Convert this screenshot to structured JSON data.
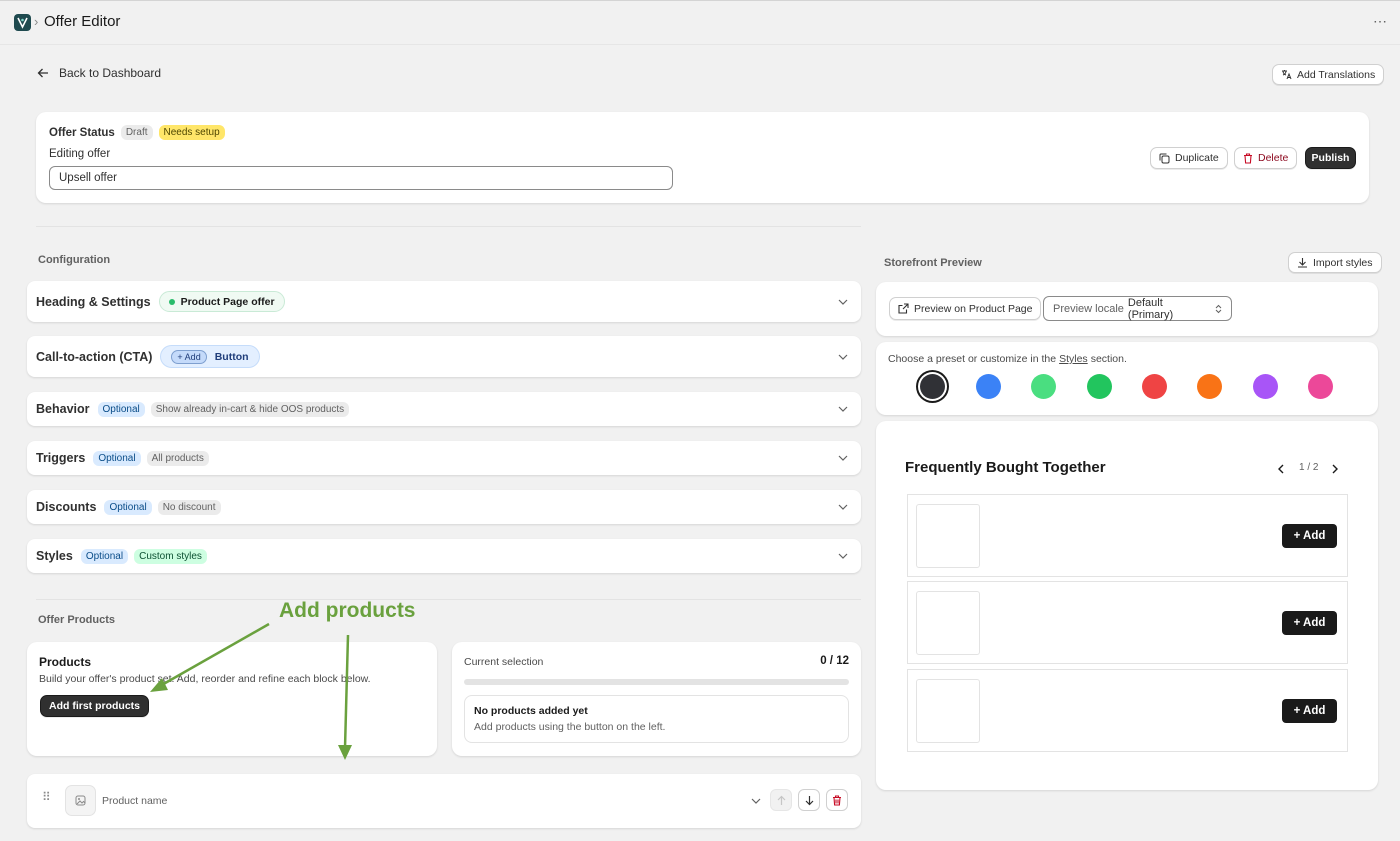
{
  "topbar": {
    "crumb_sep": "›",
    "title": "Offer Editor",
    "more": "⋯"
  },
  "header": {
    "back_label": "Back to Dashboard",
    "translations_label": "Add Translations"
  },
  "status_card": {
    "label": "Offer Status",
    "badges": [
      "Draft",
      "Needs setup"
    ],
    "editing_label": "Editing offer",
    "name_value": "Upsell offer",
    "duplicate_label": "Duplicate",
    "delete_label": "Delete",
    "publish_label": "Publish"
  },
  "configuration": {
    "title": "Configuration",
    "sections": [
      {
        "title": "Heading & Settings",
        "badges": [
          "Product Page offer"
        ]
      },
      {
        "title": "Call-to-action (CTA)",
        "badges": [
          "+ Add",
          "Button"
        ]
      },
      {
        "title": "Behavior",
        "badges": [
          "Optional",
          "Show already in-cart & hide OOS products"
        ]
      },
      {
        "title": "Triggers",
        "badges": [
          "Optional",
          "All products"
        ]
      },
      {
        "title": "Discounts",
        "badges": [
          "Optional",
          "No discount"
        ]
      },
      {
        "title": "Styles",
        "badges": [
          "Optional",
          "Custom styles"
        ]
      }
    ]
  },
  "offer_products": {
    "title": "Offer Products",
    "annotation": "Add products",
    "products_title": "Products",
    "products_desc": "Build your offer's product set. Add, reorder and refine each block below.",
    "add_first_label": "Add first products",
    "current_selection_label": "Current selection",
    "selection_count": "0 / 12",
    "selection_progress": 0,
    "empty_title": "No products added yet",
    "empty_desc": "Add products using the button on the left.",
    "product_row_name": "Product name"
  },
  "preview": {
    "title": "Storefront Preview",
    "import_label": "Import styles",
    "preview_product_page_label": "Preview on Product Page",
    "locale_label": "Preview locale",
    "locale_value": "Default (Primary)",
    "preset_text_before": "Choose a preset or customize in the",
    "preset_link": "Styles",
    "preset_text_after": "section.",
    "swatches": [
      "#303136",
      "#3b82f6",
      "#4ade80",
      "#22c55e",
      "#ef4444",
      "#f97316",
      "#a855f7",
      "#ec4899"
    ],
    "widget_title": "Frequently Bought Together",
    "pagination": "1 / 2",
    "add_labels": [
      "+ Add",
      "+ Add",
      "+ Add"
    ]
  },
  "colors": {
    "accent_dark": "#1a1a1a",
    "annotation_green": "#6aa13e",
    "delete_red": "#c70a24"
  }
}
